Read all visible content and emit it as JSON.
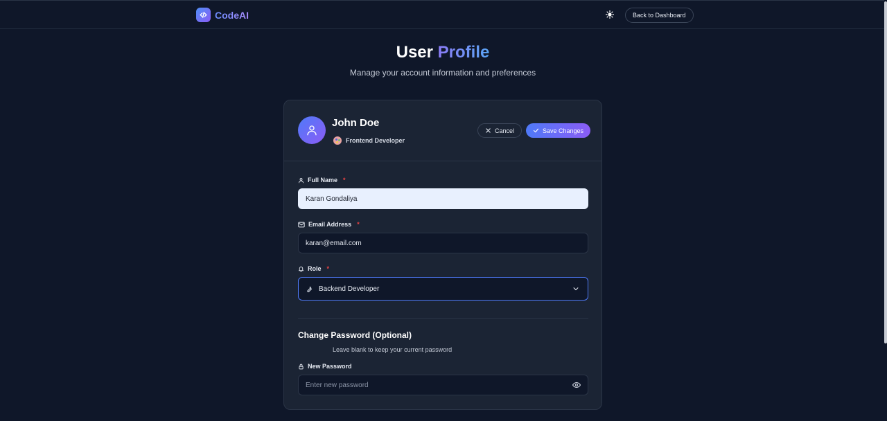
{
  "nav": {
    "brand": "CodeAI",
    "back_button": "Back to Dashboard",
    "theme_icon": "sun-icon"
  },
  "page": {
    "title_plain": "User",
    "title_accent": "Profile",
    "subtitle": "Manage your account information and preferences"
  },
  "profile": {
    "name": "John Doe",
    "role": "Frontend Developer",
    "cancel_label": "Cancel",
    "save_label": "Save Changes"
  },
  "form": {
    "full_name": {
      "label": "Full Name",
      "value": "Karan Gondaliya",
      "required": "*"
    },
    "email": {
      "label": "Email Address",
      "value": "karan@email.com",
      "required": "*"
    },
    "role": {
      "label": "Role",
      "value": "Backend Developer",
      "required": "*"
    },
    "password_section": {
      "title": "Change Password (Optional)",
      "hint": "Leave blank to keep your current password",
      "new_password_label": "New Password",
      "new_password_placeholder": "Enter new password"
    }
  },
  "colors": {
    "background": "#0f1729",
    "card": "#1b2434",
    "accent_blue": "#4f7af8",
    "accent_purple": "#8b5cf6",
    "required": "#ef4444"
  }
}
